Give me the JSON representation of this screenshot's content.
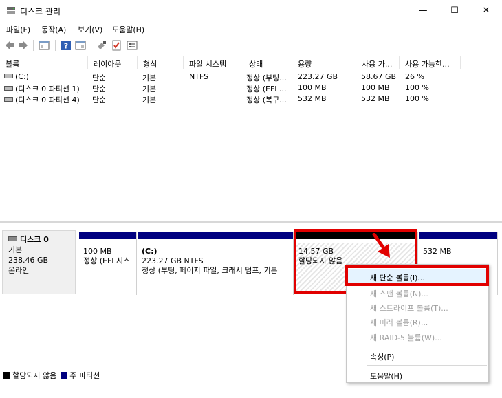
{
  "window": {
    "title": "디스크 관리",
    "minimize": "—",
    "maximize": "☐",
    "close": "✕"
  },
  "menu": [
    "파일(F)",
    "동작(A)",
    "보기(V)",
    "도움말(H)"
  ],
  "volume_table": {
    "columns": [
      "볼륨",
      "레이아웃",
      "형식",
      "파일 시스템",
      "상태",
      "용량",
      "사용 가...",
      "사용 가능한..."
    ],
    "rows": [
      [
        "(C:)",
        "단순",
        "기본",
        "NTFS",
        "정상 (부팅...",
        "223.27 GB",
        "58.67 GB",
        "26 %"
      ],
      [
        "(디스크 0 파티션 1)",
        "단순",
        "기본",
        "",
        "정상 (EFI ...",
        "100 MB",
        "100 MB",
        "100 %"
      ],
      [
        "(디스크 0 파티션 4)",
        "단순",
        "기본",
        "",
        "정상 (복구...",
        "532 MB",
        "532 MB",
        "100 %"
      ]
    ]
  },
  "disk": {
    "name": "디스크 0",
    "type": "기본",
    "size": "238.46 GB",
    "status": "온라인"
  },
  "partitions": [
    {
      "name": "",
      "size": "100 MB",
      "status": "정상 (EFI 시스"
    },
    {
      "name": "(C:)",
      "size": "223.27 GB NTFS",
      "status": "정상 (부팅, 페이지 파일, 크래시 덤프, 기본"
    },
    {
      "name": "",
      "size": "14.57 GB",
      "status": "할당되지 않음"
    },
    {
      "name": "",
      "size": "532 MB",
      "status": ""
    }
  ],
  "legend": [
    {
      "label": "할당되지 않음",
      "color": "#000000"
    },
    {
      "label": "주 파티션",
      "color": "#000080"
    }
  ],
  "context_menu": {
    "items": [
      {
        "label": "새 단순 볼륨(I)...",
        "enabled": true
      },
      {
        "label": "새 스팬 볼륨(N)...",
        "enabled": false
      },
      {
        "label": "새 스트라이프 볼륨(T)...",
        "enabled": false
      },
      {
        "label": "새 미러 볼륨(R)...",
        "enabled": false
      },
      {
        "label": "새 RAID-5 볼륨(W)...",
        "enabled": false
      },
      {
        "label": "속성(P)",
        "enabled": true
      },
      {
        "label": "도움말(H)",
        "enabled": true
      }
    ]
  },
  "colors": {
    "primary_partition": "#000080",
    "unallocated": "#000000",
    "highlight_box": "#e10000"
  }
}
